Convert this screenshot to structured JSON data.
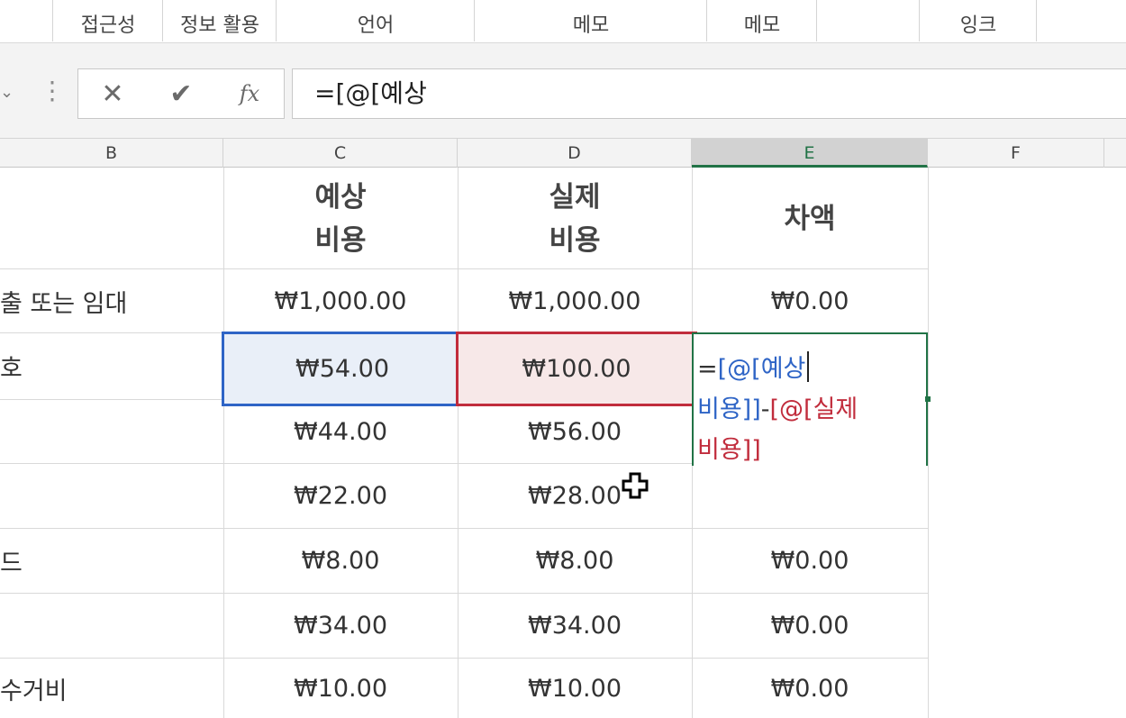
{
  "ribbon": {
    "labels": [
      "접근성",
      "정보 활용",
      "언어",
      "메모",
      "메모",
      "잉크"
    ]
  },
  "formula_bar": {
    "cancel_icon": "✕",
    "enter_icon": "✔",
    "fx_icon": "fx",
    "formula": "=[@[예상"
  },
  "columns": [
    "B",
    "C",
    "D",
    "E",
    "F"
  ],
  "header_row": {
    "c": [
      "예상",
      "비용"
    ],
    "d": [
      "실제",
      "비용"
    ],
    "e": "차액"
  },
  "rows": [
    {
      "b": "출 또는 임대",
      "c": "₩1,000.00",
      "d": "₩1,000.00",
      "e": "₩0.00"
    },
    {
      "b": "호",
      "c": "₩54.00",
      "d": "₩100.00",
      "e": ""
    },
    {
      "b": "",
      "c": "₩44.00",
      "d": "₩56.00",
      "e": ""
    },
    {
      "b": "",
      "c": "₩22.00",
      "d": "₩28.00",
      "e": ""
    },
    {
      "b": "드",
      "c": "₩8.00",
      "d": "₩8.00",
      "e": "₩0.00"
    },
    {
      "b": "",
      "c": "₩34.00",
      "d": "₩34.00",
      "e": "₩0.00"
    },
    {
      "b": "수거비",
      "c": "₩10.00",
      "d": "₩10.00",
      "e": "₩0.00"
    }
  ],
  "editing": {
    "part1": "[@[예상",
    "part2": "비용]]",
    "minus": "-",
    "part3": "[@[실제",
    "part4": "비용]]",
    "eq": "="
  },
  "colors": {
    "accent_green": "#217346",
    "ref_blue": "#2e64c6",
    "ref_red": "#c12c3c"
  }
}
